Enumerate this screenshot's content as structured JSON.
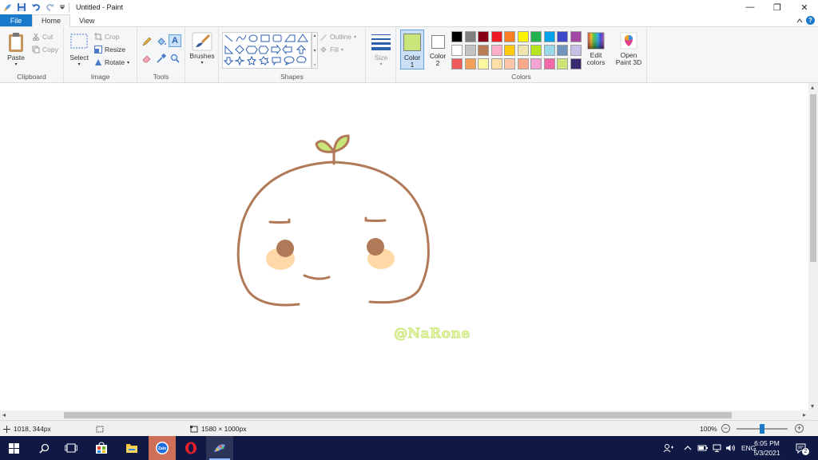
{
  "window": {
    "title": "Untitled - Paint",
    "controls": {
      "minimize": "—",
      "maximize": "❐",
      "close": "✕"
    }
  },
  "tabs": [
    {
      "label": "File"
    },
    {
      "label": "Home"
    },
    {
      "label": "View"
    }
  ],
  "ribbon": {
    "clipboard": {
      "group_label": "Clipboard",
      "paste": "Paste",
      "cut": "Cut",
      "copy": "Copy"
    },
    "image": {
      "group_label": "Image",
      "select": "Select",
      "crop": "Crop",
      "resize": "Resize",
      "rotate": "Rotate"
    },
    "tools": {
      "group_label": "Tools"
    },
    "brushes": {
      "label": "Brushes"
    },
    "shapes": {
      "group_label": "Shapes",
      "outline": "Outline",
      "fill": "Fill"
    },
    "size": {
      "label": "Size"
    },
    "colors": {
      "group_label": "Colors",
      "color1_label": "Color",
      "color1_num": "1",
      "color2_label": "Color",
      "color2_num": "2",
      "color1_value": "#c8e67a",
      "color2_value": "#ffffff",
      "edit_label": "Edit",
      "edit_label2": "colors",
      "palette_row1": [
        "#000000",
        "#7f7f7f",
        "#880015",
        "#ed1c24",
        "#ff7f27",
        "#fff200",
        "#22b14c",
        "#00a2e8",
        "#3f48cc",
        "#a349a4"
      ],
      "palette_row2": [
        "#ffffff",
        "#c3c3c3",
        "#b97a57",
        "#ffaec9",
        "#ffc90e",
        "#efe4b0",
        "#b5e61d",
        "#99d9ea",
        "#7092be",
        "#c8bfe7"
      ],
      "palette_row3": [
        "#ee5a5a",
        "#f5a05a",
        "#fcf8a0",
        "#fde0a8",
        "#fcc6a8",
        "#f9a88a",
        "#f4a4d4",
        "#ee6aa8",
        "#c8e67a",
        "#3a2870"
      ]
    },
    "paint3d": {
      "label": "Open",
      "label2": "Paint 3D"
    }
  },
  "canvas": {
    "watermark": "@NaRone",
    "stroke_color": "#b07a58",
    "cheek_color": "#ffd8a8",
    "sprout_color": "#c8e67a"
  },
  "status": {
    "cursor_pos": "1018, 344px",
    "image_size": "1580 × 1000px",
    "zoom": "100%",
    "zoom_level_percent": 100
  },
  "taskbar": {
    "lang": "ENG",
    "time": "6:05 PM",
    "date": "5/3/2021",
    "notification_count": "2"
  }
}
